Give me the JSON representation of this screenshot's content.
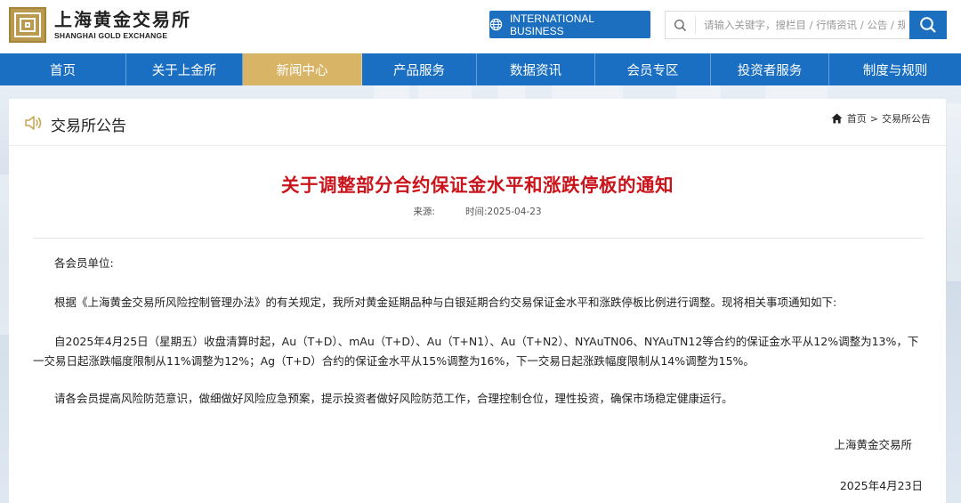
{
  "header": {
    "logo_cn": "上海黄金交易所",
    "logo_en": "SHANGHAI GOLD EXCHANGE",
    "intl_label": "INTERNATIONAL BUSINESS",
    "search_placeholder": "请输入关键字，搜栏目 / 行情资讯 / 公告 / 规则"
  },
  "nav": {
    "items": [
      {
        "label": "首页"
      },
      {
        "label": "关于上金所"
      },
      {
        "label": "新闻中心",
        "active": true
      },
      {
        "label": "产品服务"
      },
      {
        "label": "数据资讯"
      },
      {
        "label": "会员专区"
      },
      {
        "label": "投资者服务"
      },
      {
        "label": "制度与规则"
      }
    ]
  },
  "section": {
    "title": "交易所公告",
    "breadcrumb": [
      "首页",
      "交易所公告"
    ]
  },
  "article": {
    "title": "关于调整部分合约保证金水平和涨跌停板的通知",
    "source_label": "来源:",
    "time_label": "时间:",
    "time_value": "2025-04-23",
    "salutation": "各会员单位:",
    "para1": "根据《上海黄金交易所风险控制管理办法》的有关规定，我所对黄金延期品种与白银延期合约交易保证金水平和涨跌停板比例进行调整。现将相关事项通知如下:",
    "para2": "自2025年4月25日（星期五）收盘清算时起，Au（T+D）、mAu（T+D）、Au（T+N1）、Au（T+N2）、NYAuTN06、NYAuTN12等合约的保证金水平从12%调整为13%，下一交易日起涨跌幅度限制从11%调整为12%；Ag（T+D）合约的保证金水平从15%调整为16%，下一交易日起涨跌幅度限制从14%调整为15%。",
    "para3": "请各会员提高风险防范意识，做细做好风险应急预案，提示投资者做好风险防范工作，合理控制仓位，理性投资，确保市场稳定健康运行。",
    "signature": "上海黄金交易所",
    "date": "2025年4月23日"
  },
  "colors": {
    "nav_bg": "#1a6fc2",
    "nav_active": "#d8b467",
    "title_red": "#c9141b",
    "brand_gold": "#b99a4e"
  }
}
